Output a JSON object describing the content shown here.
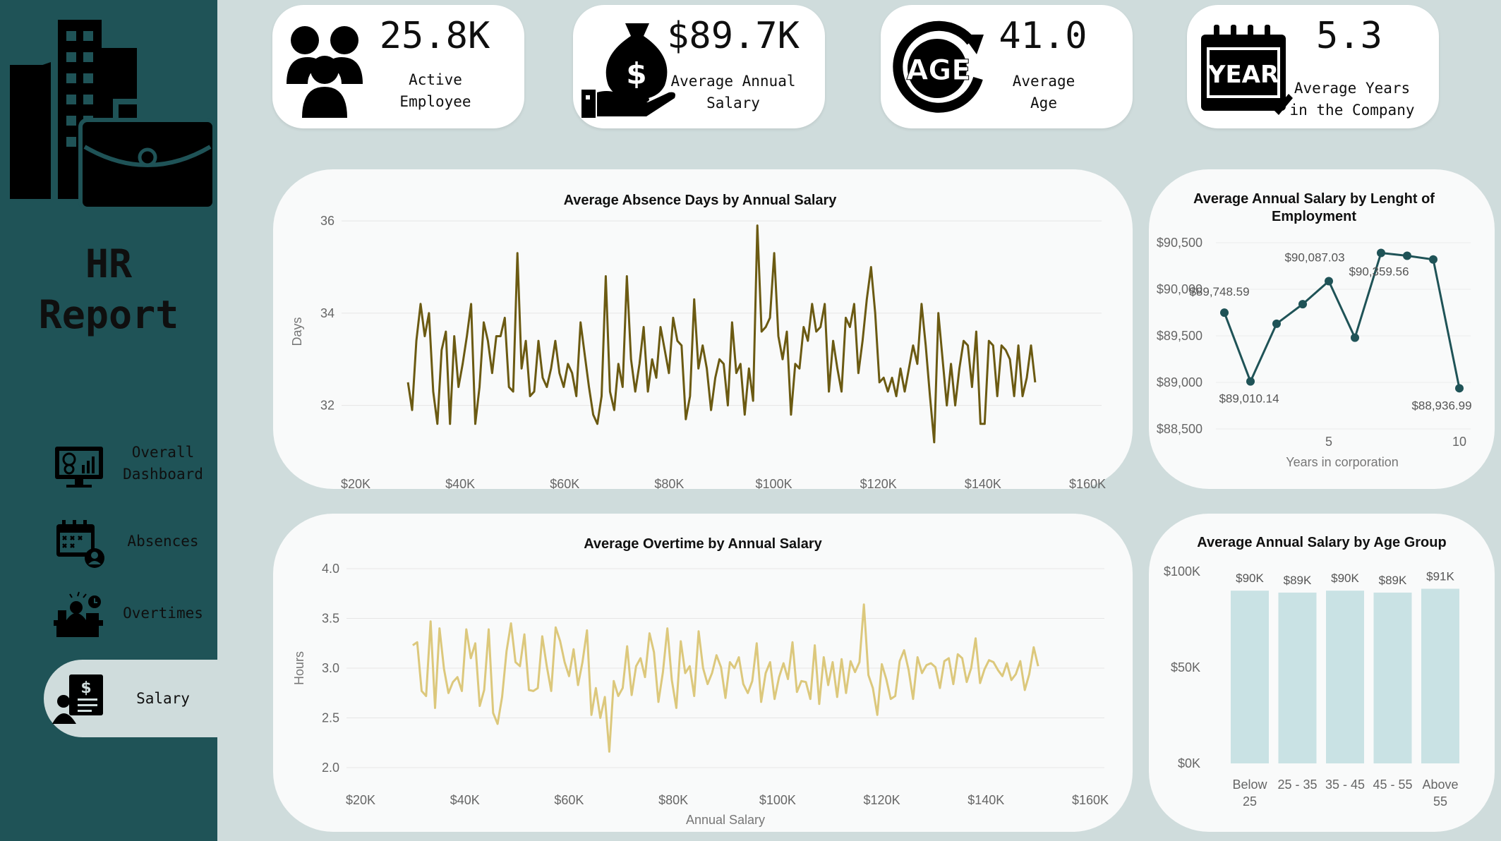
{
  "sidebar": {
    "title": "HR\nReport",
    "nav": [
      {
        "label": "Overall\nDashboard",
        "icon": "dashboard-monitor-icon",
        "active": false
      },
      {
        "label": "Absences",
        "icon": "calendar-user-icon",
        "active": false
      },
      {
        "label": "Overtimes",
        "icon": "desk-clock-icon",
        "active": false
      },
      {
        "label": "Salary",
        "icon": "salary-document-icon",
        "active": true
      }
    ]
  },
  "kpis": [
    {
      "value": "25.8K",
      "label": "Active\nEmployee",
      "icon": "people-group-icon"
    },
    {
      "value": "$89.7K",
      "label": "Average Annual\nSalary",
      "icon": "money-bag-hand-icon"
    },
    {
      "value": "41.0",
      "label": "Average\nAge",
      "icon": "age-cycle-icon"
    },
    {
      "value": "5.3",
      "label": "Average Years\nin the Company",
      "icon": "year-calendar-icon"
    }
  ],
  "colors": {
    "sidebar": "#1f5357",
    "background": "#cfdcdc",
    "absence_line": "#6b5a12",
    "overtime_line": "#dcc87c",
    "tenure_line": "#1f5357",
    "age_bars": "#c9e2e4"
  },
  "chart_data": [
    {
      "type": "line",
      "title": "Average Absence Days by Annual Salary",
      "xlabel": "Annual Salary",
      "ylabel": "Days",
      "xlim": [
        20000,
        160000
      ],
      "ylim": [
        31,
        36.2
      ],
      "x_ticks": [
        "$20K",
        "$40K",
        "$60K",
        "$80K",
        "$100K",
        "$120K",
        "$140K",
        "$160K"
      ],
      "y_ticks": [
        "32",
        "34",
        "36"
      ],
      "x_start": 30000,
      "x_step": 1000,
      "y": [
        32.5,
        31.9,
        33.4,
        34.2,
        33.5,
        34.0,
        32.3,
        31.6,
        33.2,
        33.6,
        31.6,
        33.5,
        32.4,
        32.9,
        33.5,
        34.2,
        31.6,
        32.4,
        33.8,
        33.4,
        32.7,
        33.5,
        33.5,
        33.9,
        32.4,
        32.3,
        35.3,
        32.8,
        33.4,
        32.2,
        32.3,
        33.4,
        32.6,
        32.4,
        32.8,
        33.4,
        32.7,
        32.4,
        32.9,
        32.7,
        32.2,
        33.8,
        33.1,
        32.4,
        31.8,
        31.6,
        32.2,
        34.8,
        32.3,
        31.9,
        32.9,
        32.4,
        34.8,
        33.0,
        32.3,
        32.9,
        33.7,
        32.3,
        33.0,
        32.6,
        33.7,
        33.2,
        32.7,
        33.9,
        33.4,
        33.3,
        31.7,
        32.2,
        34.3,
        32.8,
        33.3,
        32.8,
        31.9,
        32.6,
        33.0,
        32.9,
        32.0,
        33.8,
        32.7,
        32.9,
        31.8,
        32.8,
        32.1,
        35.9,
        33.6,
        33.7,
        33.9,
        35.3,
        33.5,
        33.0,
        33.6,
        31.8,
        32.9,
        32.8,
        33.7,
        33.4,
        34.2,
        33.6,
        33.7,
        34.2,
        32.3,
        33.4,
        32.8,
        32.3,
        33.9,
        33.7,
        34.2,
        32.7,
        33.4,
        34.3,
        35.0,
        34.0,
        32.5,
        32.6,
        32.3,
        32.6,
        32.2,
        32.8,
        32.3,
        32.8,
        33.3,
        32.9,
        34.2,
        33.3,
        32.2,
        31.2,
        34.0,
        33.0,
        32.0,
        32.9,
        32.0,
        32.8,
        33.4,
        33.3,
        32.4,
        33.6,
        31.6,
        31.6,
        33.4,
        33.3,
        32.2,
        33.3,
        33.2,
        33.0,
        32.2,
        33.3,
        32.2,
        32.6,
        33.3,
        32.5
      ],
      "sample_note_points": 121
    },
    {
      "type": "line",
      "title": "Average Overtime by Annual Salary",
      "xlabel": "Annual Salary",
      "ylabel": "Hours",
      "xlim": [
        20000,
        160000
      ],
      "ylim": [
        2.0,
        4.0
      ],
      "x_ticks": [
        "$20K",
        "$40K",
        "$60K",
        "$80K",
        "$100K",
        "$120K",
        "$140K",
        "$160K"
      ],
      "y_ticks": [
        "2.0",
        "2.5",
        "3.0",
        "3.5",
        "4.0"
      ],
      "x_start": 30000,
      "x_step": 1000,
      "y": [
        3.23,
        3.26,
        2.77,
        2.72,
        3.47,
        2.6,
        3.4,
        2.99,
        2.75,
        2.86,
        2.91,
        2.77,
        3.39,
        3.1,
        3.25,
        2.62,
        2.78,
        3.39,
        2.55,
        2.44,
        2.71,
        3.17,
        3.45,
        3.06,
        3.02,
        3.34,
        2.78,
        2.77,
        2.8,
        3.32,
        3.02,
        2.77,
        3.41,
        3.27,
        3.06,
        2.92,
        3.19,
        2.83,
        3.06,
        3.38,
        2.53,
        2.8,
        2.5,
        2.71,
        2.16,
        2.87,
        2.72,
        2.8,
        3.22,
        2.73,
        3.02,
        3.1,
        2.91,
        3.35,
        3.16,
        2.66,
        2.96,
        3.4,
        2.88,
        2.6,
        3.27,
        2.95,
        3.02,
        2.72,
        3.37,
        3.0,
        2.84,
        2.95,
        3.13,
        3.01,
        2.7,
        3.06,
        3.0,
        3.11,
        2.84,
        2.75,
        2.87,
        3.25,
        2.66,
        2.95,
        3.06,
        2.69,
        2.91,
        3.05,
        2.89,
        3.26,
        2.76,
        2.87,
        2.86,
        2.69,
        3.23,
        2.64,
        3.11,
        2.83,
        3.06,
        2.71,
        3.09,
        2.75,
        3.07,
        2.96,
        3.06,
        3.64,
        2.93,
        2.8,
        2.53,
        3.04,
        2.89,
        2.69,
        2.72,
        3.07,
        3.18,
        2.98,
        2.69,
        3.11,
        2.95,
        3.03,
        3.05,
        3.01,
        2.8,
        3.07,
        3.1,
        2.84,
        3.14,
        3.1,
        2.86,
        3.0,
        3.3,
        2.85,
        2.99,
        3.08,
        3.06,
        2.98,
        2.92,
        3.05,
        2.88,
        2.94,
        3.07,
        2.78,
        2.94,
        3.21,
        3.02
      ],
      "sample_note_points": 121
    },
    {
      "type": "line",
      "title": "Average Annual Salary by Lenght of Employment",
      "xlabel": "Years in corporation",
      "ylabel": "",
      "ylim": [
        88500,
        90500
      ],
      "x_ticks": [
        "5",
        "10"
      ],
      "y_ticks": [
        "$88,500",
        "$89,000",
        "$89,500",
        "$90,000",
        "$90,500"
      ],
      "x": [
        1,
        2,
        3,
        4,
        5,
        6,
        7,
        8,
        9,
        10
      ],
      "y": [
        89748.59,
        89010.14,
        89630,
        89840,
        90087.03,
        89480,
        90390,
        90359.56,
        90320,
        88936.99
      ],
      "data_labels": [
        "$89,748.59",
        "$89,010.14",
        "",
        "",
        "$90,087.03",
        "",
        "",
        "$90,359.56",
        "",
        "$88,936.99"
      ]
    },
    {
      "type": "bar",
      "title": "Average Annual Salary by Age Group",
      "categories": [
        "Below\n25",
        "25 - 35",
        "35 - 45",
        "45 - 55",
        "Above\n55"
      ],
      "values": [
        90000,
        89000,
        90000,
        89000,
        91000
      ],
      "data_labels": [
        "$90K",
        "$89K",
        "$90K",
        "$89K",
        "$91K"
      ],
      "ylim": [
        0,
        100000
      ],
      "y_ticks": [
        "$0K",
        "$50K",
        "$100K"
      ]
    }
  ]
}
